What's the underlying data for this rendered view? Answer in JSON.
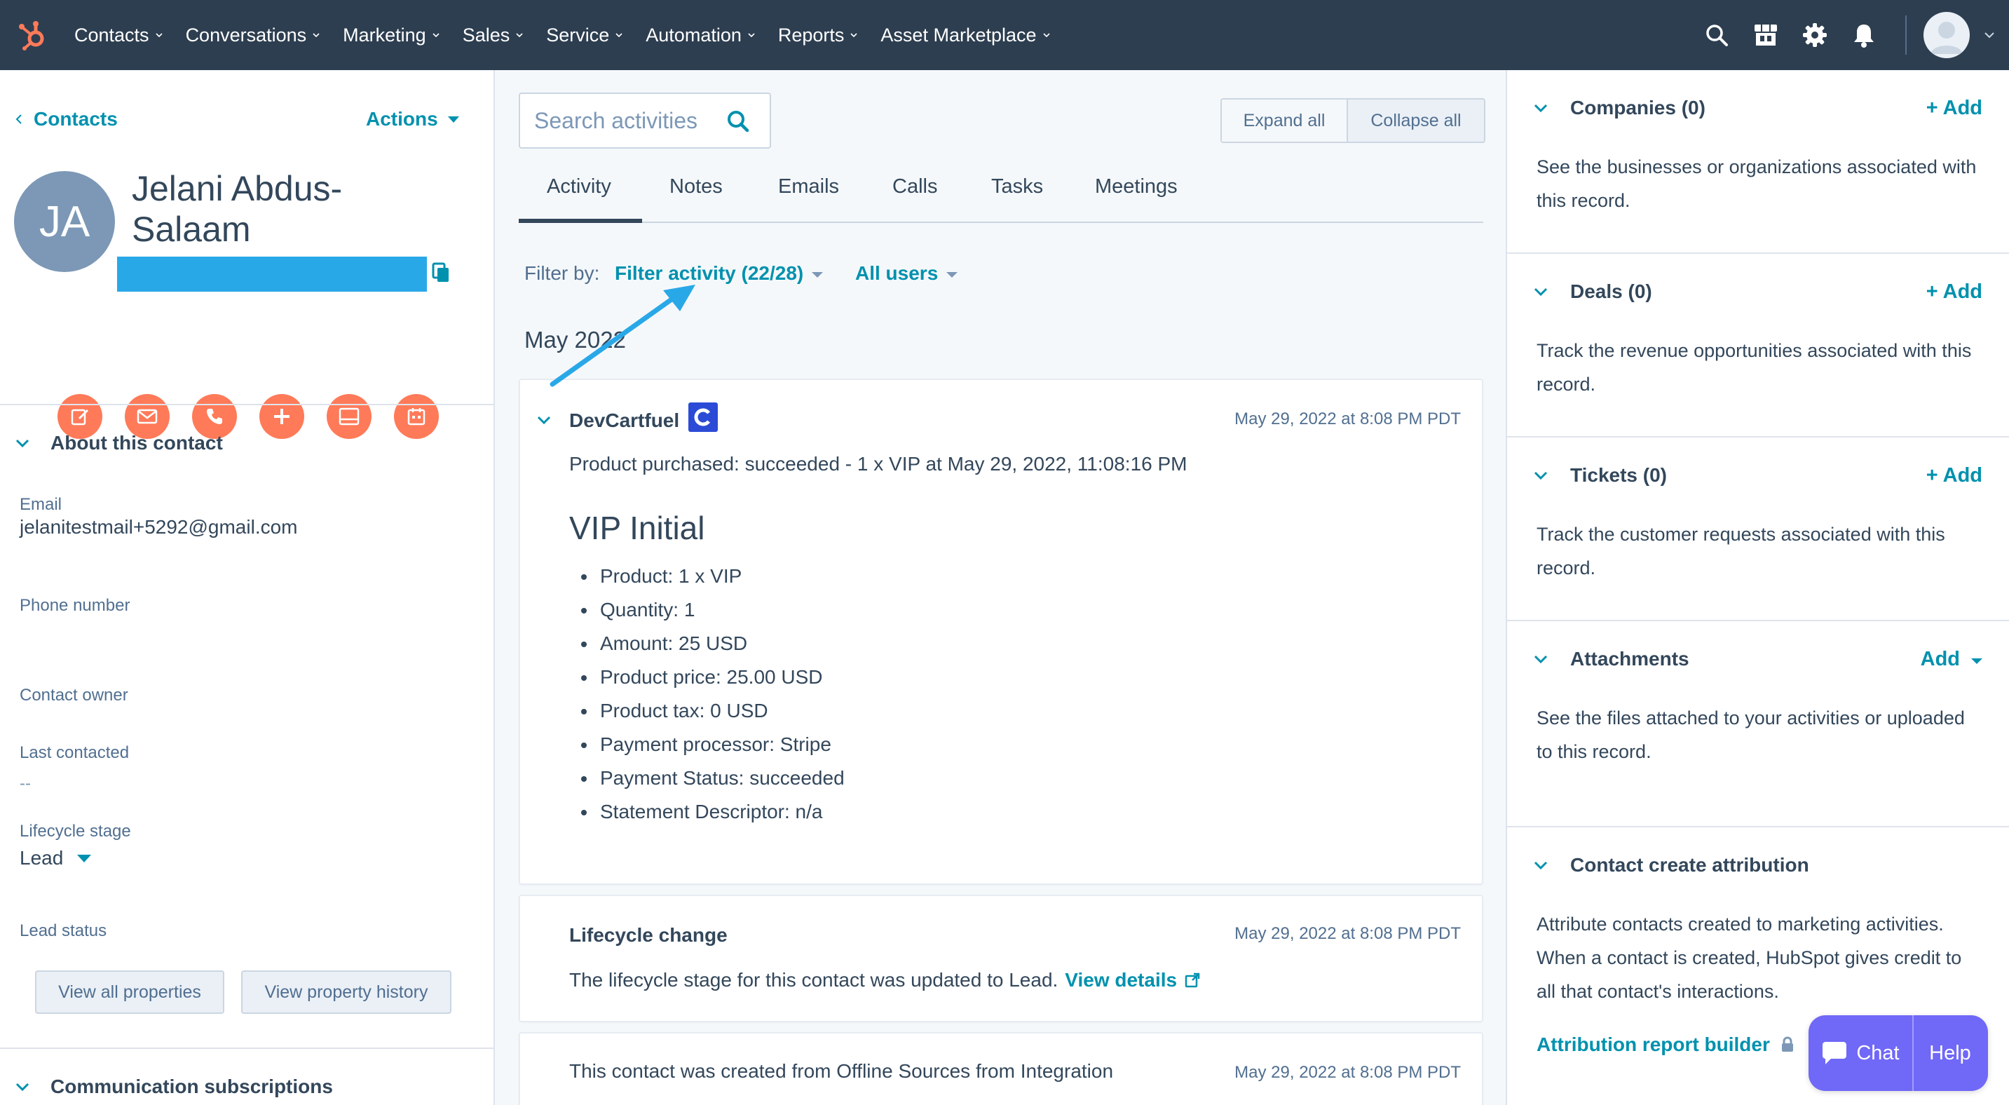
{
  "nav": {
    "items": [
      "Contacts",
      "Conversations",
      "Marketing",
      "Sales",
      "Service",
      "Automation",
      "Reports",
      "Asset Marketplace"
    ]
  },
  "left": {
    "back_label": "Contacts",
    "actions_label": "Actions",
    "initials": "JA",
    "name": "Jelani Abdus-Salaam",
    "about_title": "About this contact",
    "email_label": "Email",
    "email_value": "jelanitestmail+5292@gmail.com",
    "phone_label": "Phone number",
    "owner_label": "Contact owner",
    "last_contacted_label": "Last contacted",
    "last_contacted_value": "--",
    "lifecycle_label": "Lifecycle stage",
    "lifecycle_value": "Lead",
    "lead_status_label": "Lead status",
    "view_all_label": "View all properties",
    "view_history_label": "View property history",
    "comm_title": "Communication subscriptions"
  },
  "center": {
    "search_placeholder": "Search activities",
    "expand_label": "Expand all",
    "collapse_label": "Collapse all",
    "tabs": [
      "Activity",
      "Notes",
      "Emails",
      "Calls",
      "Tasks",
      "Meetings"
    ],
    "filter_by": "Filter by:",
    "filter_activity": "Filter activity (22/28)",
    "all_users": "All users",
    "month": "May 2022",
    "card1": {
      "title": "DevCartfuel",
      "time": "May 29, 2022 at 8:08 PM PDT",
      "summary": "Product purchased: succeeded - 1 x VIP at May 29, 2022, 11:08:16 PM",
      "heading": "VIP Initial",
      "bullets": [
        "Product: 1 x VIP",
        "Quantity: 1",
        "Amount: 25 USD",
        "Product price: 25.00 USD",
        "Product tax: 0 USD",
        "Payment processor: Stripe",
        "Payment Status: succeeded",
        "Statement Descriptor: n/a"
      ]
    },
    "card2": {
      "title": "Lifecycle change",
      "time": "May 29, 2022 at 8:08 PM PDT",
      "text": "The lifecycle stage for this contact was updated to Lead.",
      "link": "View details"
    },
    "card3": {
      "text": "This contact was created from Offline Sources from Integration",
      "time": "May 29, 2022 at 8:08 PM PDT"
    }
  },
  "right": {
    "companies_title": "Companies (0)",
    "companies_text": "See the businesses or organizations associated with this record.",
    "deals_title": "Deals (0)",
    "deals_text": "Track the revenue opportunities associated with this record.",
    "tickets_title": "Tickets (0)",
    "tickets_text": "Track the customer requests associated with this record.",
    "attachments_title": "Attachments",
    "attachments_text": "See the files attached to your activities or uploaded to this record.",
    "attribution_title": "Contact create attribution",
    "attribution_text": "Attribute contacts created to marketing activities. When a contact is created, HubSpot gives credit to all that contact's interactions.",
    "attribution_link": "Attribution report builder",
    "add_label": "+ Add",
    "add_plain_label": "Add"
  },
  "widget": {
    "chat_label": "Chat",
    "help_label": "Help"
  },
  "colors": {
    "nav_bg": "#2d3e50",
    "accent_teal": "#0091ae",
    "orange": "#ff7a59",
    "annotation_arrow": "#29a8e8",
    "chat_purple": "#7068f7"
  }
}
